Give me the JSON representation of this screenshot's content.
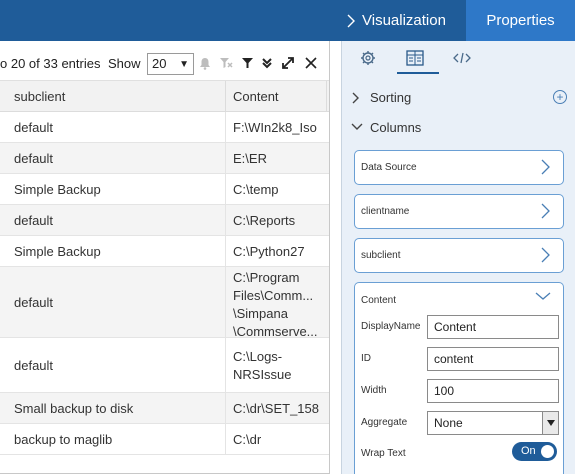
{
  "table": {
    "paging_text": "o 20 of 33 entries",
    "show_label": "Show",
    "page_size": "20",
    "columns": [
      "subclient",
      "Content"
    ],
    "rows": [
      {
        "subclient": "default",
        "content": [
          "F:\\WIn2k8_Iso"
        ]
      },
      {
        "subclient": "default",
        "content": [
          "E:\\ER"
        ]
      },
      {
        "subclient": "Simple Backup",
        "content": [
          "C:\\temp"
        ]
      },
      {
        "subclient": "default",
        "content": [
          "C:\\Reports"
        ]
      },
      {
        "subclient": "Simple Backup",
        "content": [
          "C:\\Python27"
        ]
      },
      {
        "subclient": "default",
        "content": [
          "C:\\Program",
          "Files\\Comm...",
          "\\Simpana",
          "\\Commserve..."
        ]
      },
      {
        "subclient": "default",
        "content": [
          "C:\\Logs-",
          "NRSIssue"
        ]
      },
      {
        "subclient": "Small backup to disk",
        "content": [
          "C:\\dr\\SET_158"
        ]
      },
      {
        "subclient": "backup to maglib",
        "content": [
          "C:\\dr"
        ]
      }
    ],
    "icons": [
      "bell-icon",
      "clear-filter-icon",
      "filter-icon",
      "collapse-icon",
      "expand-icon",
      "close-icon"
    ]
  },
  "panel": {
    "tab_visualization": "Visualization",
    "tab_properties": "Properties",
    "toolbar_icons": [
      "gear-icon",
      "table-icon",
      "code-icon"
    ],
    "sorting_label": "Sorting",
    "columns_label": "Columns",
    "column_cards": [
      "Data Source",
      "clientname",
      "subclient"
    ],
    "open_column": {
      "title": "Content",
      "display_name_label": "DisplayName",
      "display_name_value": "Content",
      "id_label": "ID",
      "id_value": "content",
      "width_label": "Width",
      "width_value": "100",
      "aggregate_label": "Aggregate",
      "aggregate_value": "None",
      "wrap_label": "Wrap Text",
      "wrap_value": "On"
    }
  },
  "colors": {
    "header_blue": "#1f5c99",
    "active_tab": "#2e78c8",
    "panel_bg": "#e9f0f8",
    "card_border": "#6a9fd4"
  }
}
